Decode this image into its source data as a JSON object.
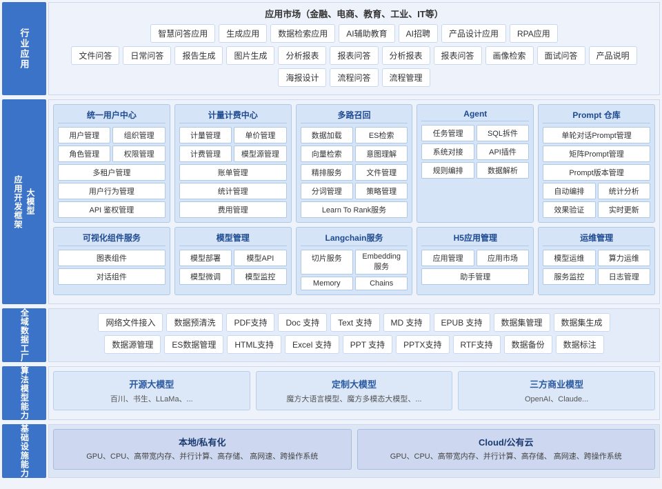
{
  "labels": {
    "industry": "行业应用",
    "framework": "大模型\n应用开发框架",
    "data": "全域数据\n工厂",
    "algo": "算法\n模型\n能力",
    "infra": "基础\n设施\n能力"
  },
  "industry": {
    "top": "应用市场（金融、电商、教育、工业、IT等）",
    "row1": [
      "智慧问答应用",
      "生成应用",
      "数据检索应用",
      "AI辅助教育",
      "AI招聘",
      "产品设计应用",
      "RPA应用"
    ],
    "row2": [
      "文件问答",
      "日常问答",
      "报告生成",
      "图片生成",
      "分析报表",
      "报表问答",
      "分析报表",
      "报表问答",
      "画像检索",
      "面试问答",
      "产品说明",
      "海报设计",
      "流程问答",
      "流程管理"
    ]
  },
  "framework": {
    "block1": {
      "title": "统一用户中心",
      "items": [
        "用户管理",
        "组织管理",
        "角色管理",
        "权限管理",
        "多租户管理",
        "用户行为管理",
        "API 鉴权管理"
      ]
    },
    "block2": {
      "title": "计量计费中心",
      "items": [
        "计量管理",
        "单价管理",
        "计费管理",
        "模型源管理",
        "账单管理",
        "统计管理",
        "费用管理"
      ]
    },
    "block3": {
      "title": "多路召回",
      "items": [
        "数据加载",
        "ES检索",
        "向量检索",
        "意图理解",
        "精排服务",
        "文件管理",
        "分词管理",
        "策略管理",
        "Learn To Rank服务"
      ]
    },
    "block4": {
      "title": "Agent",
      "items": [
        "任务管理",
        "SQL拆件",
        "系统对接",
        "API插件",
        "规则编排",
        "数据解析"
      ]
    },
    "block5": {
      "title": "Prompt 仓库",
      "items": [
        "单轮对话Prompt管理",
        "矩阵Prompt管理",
        "Prompt版本管理",
        "自动编排",
        "统计分析",
        "效果验证",
        "实时更新"
      ]
    },
    "block6": {
      "title": "可视化组件服务",
      "items": [
        "图表组件",
        "对话组件"
      ]
    },
    "block7": {
      "title": "模型管理",
      "items": [
        "模型部署",
        "模型API",
        "模型微调",
        "模型监控"
      ]
    },
    "block8": {
      "title": "Langchain服务",
      "items": [
        "切片服务",
        "Embedding服务",
        "Memory",
        "Chains"
      ]
    },
    "block9": {
      "title": "H5应用管理",
      "items": [
        "应用管理",
        "应用市场",
        "助手管理"
      ]
    },
    "block10": {
      "title": "运维管理",
      "items": [
        "模型运维",
        "算力运维",
        "服务监控",
        "日志管理"
      ]
    }
  },
  "data": {
    "row1": [
      "网络文件接入",
      "数据预清洗",
      "PDF支持",
      "Doc 支持",
      "Text 支持",
      "MD 支持",
      "EPUB 支持",
      "数据集管理",
      "数据集生成"
    ],
    "row2": [
      "数据源管理",
      "ES数据管理",
      "HTML支持",
      "Excel 支持",
      "PPT 支持",
      "PPTX支持",
      "RTF支持",
      "数据备份",
      "数据标注"
    ]
  },
  "algo": {
    "col1_title": "开源大模型",
    "col1_sub": "百川、书生、LLaMa、...",
    "col2_title": "定制大模型",
    "col2_sub": "魔方大语言模型、魔方多模态大模型、...",
    "col3_title": "三方商业模型",
    "col3_sub": "OpenAI、Claude..."
  },
  "infra": {
    "col1_title": "本地/私有化",
    "col1_sub": "GPU、CPU、高带宽内存、并行计算、高存储、\n高网速、跨操作系统",
    "col2_title": "Cloud/公有云",
    "col2_sub": "GPU、CPU、高带宽内存、并行计算、高存储、\n高网速、跨操作系统"
  }
}
